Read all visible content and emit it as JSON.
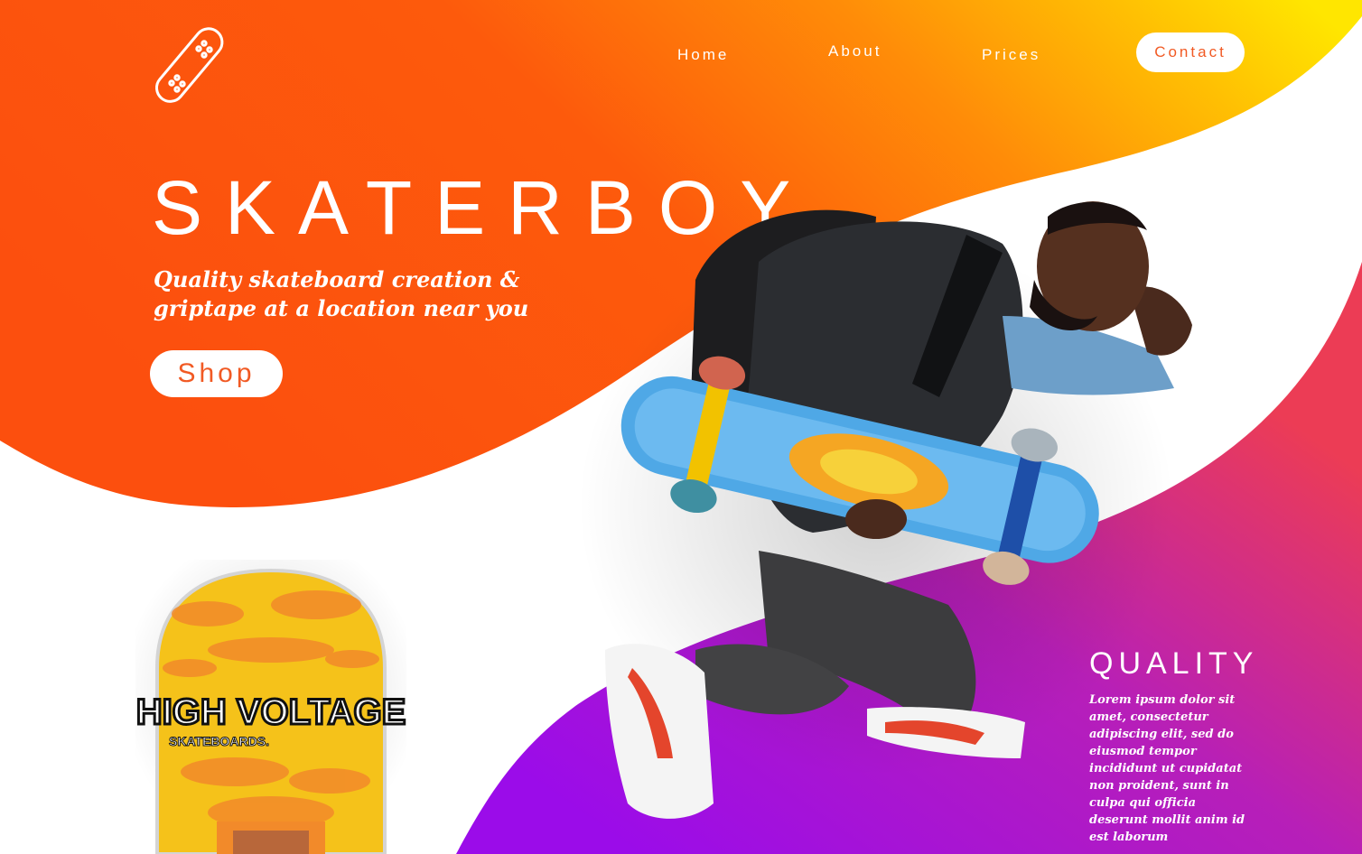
{
  "colors": {
    "orange": "#fc4f0e",
    "yellow": "#ffe100",
    "purple": "#9b0ce9",
    "magenta": "#e0336a",
    "white": "#ffffff"
  },
  "logo": {
    "icon": "skateboard-icon"
  },
  "nav": {
    "home": "Home",
    "about": "About",
    "prices": "Prices",
    "contact": "Contact"
  },
  "hero": {
    "title": "SKATERBOY",
    "tagline": "Quality skateboard creation & griptape at a location near you",
    "shop": "Shop"
  },
  "deck": {
    "brand": "HIGH VOLTAGE",
    "sub": "SKATEBOARDS."
  },
  "quality": {
    "title": "QUALITY",
    "text": "Lorem ipsum dolor sit amet, consectetur adipiscing elit, sed do eiusmod tempor incididunt ut  cupidatat non proident, sunt in culpa qui officia deserunt mollit anim id est laborum"
  }
}
